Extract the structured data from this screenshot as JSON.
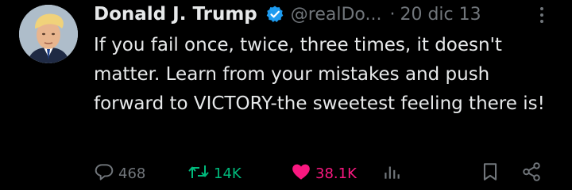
{
  "tweet": {
    "author": {
      "display_name": "Donald J. Trump",
      "handle": "@realDo...",
      "verified": true
    },
    "separator": "·",
    "timestamp": "20 dic 13",
    "text": "If you fail once, twice, three times, it doesn't matter. Learn from your mistakes and push forward to VICTORY-the sweetest feeling there is!",
    "actions": {
      "reply_count": "468",
      "retweet_count": "14K",
      "like_count": "38.1K"
    }
  },
  "icons": {
    "verified": "verified-badge-icon",
    "more": "more-icon",
    "reply": "reply-icon",
    "retweet": "retweet-icon",
    "like": "heart-icon",
    "views": "views-icon",
    "bookmark": "bookmark-icon",
    "share": "share-icon"
  },
  "colors": {
    "background": "#000000",
    "text": "#e7e9ea",
    "secondary": "#71767b",
    "verified": "#1d9bf0",
    "retweet_active": "#00ba7c",
    "like_active": "#f91880"
  }
}
